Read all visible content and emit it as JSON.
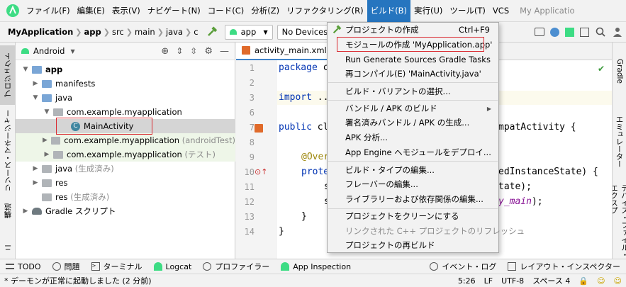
{
  "menubar": {
    "items": [
      "ファイル(F)",
      "編集(E)",
      "表示(V)",
      "ナビゲート(N)",
      "コード(C)",
      "分析(Z)",
      "リファクタリング(R)",
      "ビルド(B)",
      "実行(U)",
      "ツール(T)",
      "VCS"
    ],
    "app_title": "My Applicatio"
  },
  "navbar": {
    "crumbs": [
      "MyApplication",
      "app",
      "src",
      "main",
      "java",
      "c"
    ],
    "run_config": "app",
    "device": "No Devices"
  },
  "left_strip": {
    "tabs": [
      "プロジェクト",
      "リソース・マネージャー",
      "構造",
      "ニ"
    ]
  },
  "project": {
    "view": "Android",
    "tree": [
      {
        "label": "app",
        "hint": ""
      },
      {
        "label": "manifests",
        "hint": ""
      },
      {
        "label": "java",
        "hint": ""
      },
      {
        "label": "com.example.myapplication",
        "hint": ""
      },
      {
        "label": "MainActivity",
        "hint": ""
      },
      {
        "label": "com.example.myapplication",
        "hint": "(androidTest)"
      },
      {
        "label": "com.example.myapplication",
        "hint": "(テスト)"
      },
      {
        "label": "java",
        "hint": "(生成済み)"
      },
      {
        "label": "res",
        "hint": ""
      },
      {
        "label": "res",
        "hint": "(生成済み)"
      },
      {
        "label": "Gradle スクリプト",
        "hint": ""
      }
    ]
  },
  "editor": {
    "tab": "activity_main.xml",
    "line_numbers": [
      "1",
      "2",
      "3",
      "6",
      "7",
      "8",
      "9",
      "10",
      "11",
      "12",
      "13",
      "14"
    ],
    "code": {
      "l1_kw": "package",
      "l1_rest": " c",
      "l3_kw": "import",
      "l3_rest": " ...",
      "l7_kw": "public",
      "l7_rest": " cl",
      "l7_tail": "mpatActivity {",
      "l9": "@Over",
      "l10_kw": "prote",
      "l10_tail": "edInstanceState) {",
      "l11": "s",
      "l11_tail": "tate);",
      "l12": "s",
      "l12_tail": "y_main",
      "l12_end": ");",
      "l13": "}",
      "l14": "}"
    }
  },
  "right_strip": {
    "tabs": [
      "Gradle",
      "エミュレーター",
      "デバイス・ファイル・エクスプ"
    ]
  },
  "bottom_tools": [
    "TODO",
    "問題",
    "ターミナル",
    "Logcat",
    "プロファイラー",
    "App Inspection",
    "イベント・ログ",
    "レイアウト・インスペクター"
  ],
  "status": {
    "message": "* デーモンが正常に起動しました (2 分前)",
    "position": "5:26",
    "line_sep": "LF",
    "encoding": "UTF-8",
    "indent": "スペース 4"
  },
  "build_menu": {
    "items": [
      {
        "label": "プロジェクトの作成",
        "shortcut": "Ctrl+F9"
      },
      {
        "label": "モジュールの作成 'MyApplication.app'",
        "shortcut": ""
      },
      {
        "label": "Run Generate Sources Gradle Tasks",
        "shortcut": ""
      },
      {
        "label": "再コンパイル(E) 'MainActivity.java'",
        "shortcut": ""
      },
      {
        "label": "ビルド・バリアントの選択...",
        "shortcut": ""
      },
      {
        "label": "バンドル / APK のビルド",
        "shortcut": ""
      },
      {
        "label": "署名済みバンドル / APK の生成...",
        "shortcut": ""
      },
      {
        "label": "APK 分析...",
        "shortcut": ""
      },
      {
        "label": "App Engine へモジュールをデプロイ...",
        "shortcut": ""
      },
      {
        "label": "ビルド・タイプの編集...",
        "shortcut": ""
      },
      {
        "label": "フレーバーの編集...",
        "shortcut": ""
      },
      {
        "label": "ライブラリーおよび依存関係の編集...",
        "shortcut": ""
      },
      {
        "label": "プロジェクトをクリーンにする",
        "shortcut": ""
      },
      {
        "label": "リンクされた C++ プロジェクトのリフレッシュ",
        "shortcut": ""
      },
      {
        "label": "プロジェクトの再ビルド",
        "shortcut": ""
      }
    ]
  },
  "colors": {
    "menu_active": "#2675bf",
    "highlight_box": "#d9282f",
    "selection": "#d5d5d5"
  }
}
